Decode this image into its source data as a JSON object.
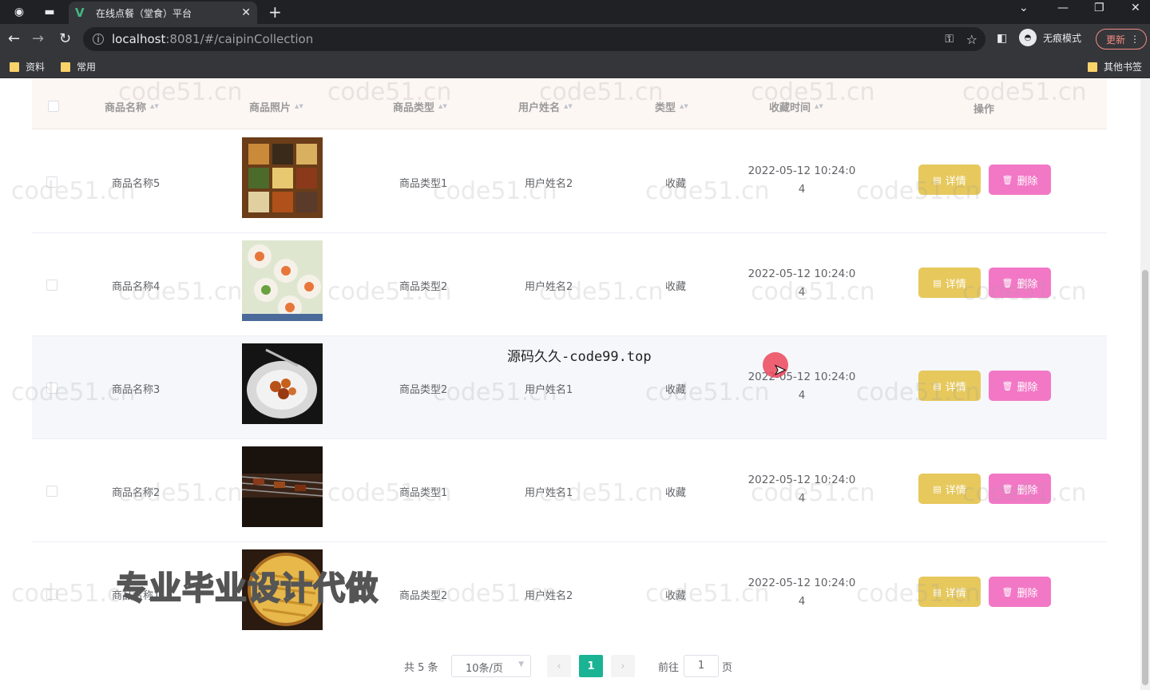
{
  "browser": {
    "tab_title": "在线点餐（堂食）平台",
    "url_host": "localhost",
    "url_path": ":8081/#/caipinCollection",
    "profile_label": "无痕模式",
    "update_label": "更新",
    "bookmarks": [
      "资料",
      "常用"
    ],
    "other_bookmarks": "其他书签"
  },
  "table": {
    "headers": {
      "name": "商品名称",
      "photo": "商品照片",
      "type": "商品类型",
      "user": "用户姓名",
      "kind": "类型",
      "time": "收藏时间",
      "ops": "操作"
    },
    "rows": [
      {
        "name": "商品名称5",
        "type": "商品类型1",
        "user": "用户姓名2",
        "kind": "收藏",
        "time_line1": "2022-05-12 10:24:0",
        "time_line2": "4",
        "photo": "bento"
      },
      {
        "name": "商品名称4",
        "type": "商品类型2",
        "user": "用户姓名2",
        "kind": "收藏",
        "time_line1": "2022-05-12 10:24:0",
        "time_line2": "4",
        "photo": "sushi"
      },
      {
        "name": "商品名称3",
        "type": "商品类型2",
        "user": "用户姓名1",
        "kind": "收藏",
        "time_line1": "2022-05-12 10:24:0",
        "time_line2": "4",
        "photo": "plate"
      },
      {
        "name": "商品名称2",
        "type": "商品类型1",
        "user": "用户姓名1",
        "kind": "收藏",
        "time_line1": "2022-05-12 10:24:0",
        "time_line2": "4",
        "photo": "grill"
      },
      {
        "name": "商品名称1",
        "type": "商品类型2",
        "user": "用户姓名2",
        "kind": "收藏",
        "time_line1": "2022-05-12 10:24:0",
        "time_line2": "4",
        "photo": "pie"
      }
    ],
    "detail_label": "详情",
    "delete_label": "删除"
  },
  "pagination": {
    "total": "共 5 条",
    "page_size": "10条/页",
    "current": "1",
    "goto_label": "前往",
    "goto_value": "1",
    "page_unit": "页"
  },
  "overlay": {
    "source_text": "源码久久-code99.top",
    "promo_text": "专业毕业设计代做",
    "watermark": "code51.cn"
  },
  "colors": {
    "detail_btn": "#e6c85c",
    "delete_btn": "#f278c6",
    "pager_active": "#1ab394",
    "header_bg": "#fdf7f4"
  }
}
